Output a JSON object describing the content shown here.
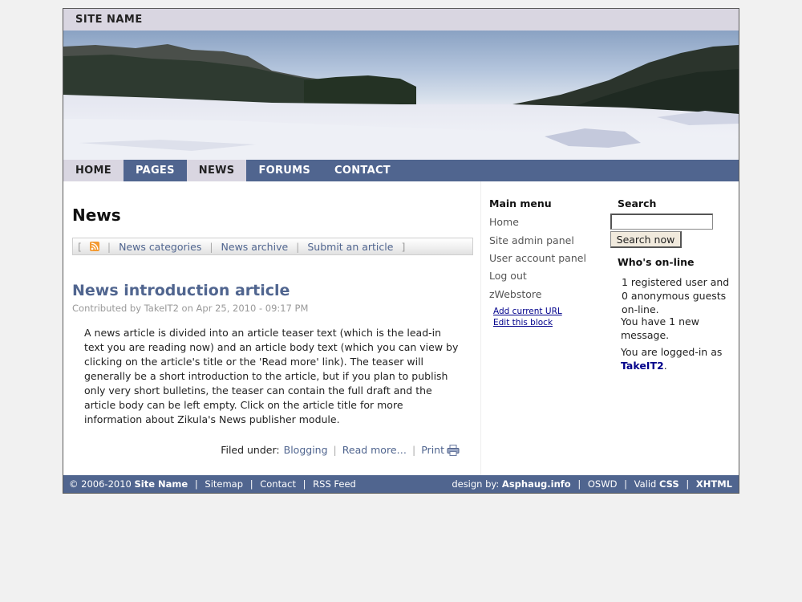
{
  "site": {
    "name": "SITE NAME"
  },
  "nav": {
    "items": [
      "HOME",
      "PAGES",
      "NEWS",
      "FORUMS",
      "CONTACT"
    ],
    "active": "NEWS"
  },
  "main": {
    "title": "News",
    "toolbar": {
      "open_bracket": "[",
      "close_bracket": "]",
      "separator": "|",
      "links": [
        "News categories",
        "News archive",
        "Submit an article"
      ]
    },
    "article": {
      "title": "News introduction article",
      "meta": "Contributed by TakeIT2 on Apr 25, 2010 - 09:17 PM",
      "body": "A news article is divided into an article teaser text (which is the lead-in text you are reading now) and an article body text (which you can view by clicking on the article's title or the 'Read more' link). The teaser will generally be a short introduction to the article, but if you plan to publish only very short bulletins, the teaser can contain the full draft and the article body can be left empty. Click on the article title for more information about Zikula's News publisher module.",
      "filed_under_label": "Filed under:",
      "category": "Blogging",
      "read_more": "Read more…",
      "print": "Print"
    }
  },
  "main_menu": {
    "title": "Main menu",
    "items": [
      "Home",
      "Site admin panel",
      "User account panel",
      "Log out",
      "zWebstore"
    ],
    "admin_links": [
      "Add current URL",
      "Edit this block"
    ]
  },
  "search": {
    "title": "Search",
    "query": "",
    "button": "Search now"
  },
  "whos_online": {
    "title": "Who's on-line",
    "summary": "1 registered user and 0 anonymous guests on-line.",
    "messages": "You have 1 new message.",
    "logged_in_prefix": "You are logged-in as",
    "username": "TakeIT2",
    "suffix": "."
  },
  "footer": {
    "copyright": "© 2006-2010",
    "site_name": "Site Name",
    "separator": "|",
    "links": [
      "Sitemap",
      "Contact",
      "RSS Feed"
    ],
    "design_label": "design by:",
    "designer": "Asphaug.info",
    "oswd": "OSWD",
    "valid_label": "Valid",
    "css": "CSS",
    "xhtml": "XHTML"
  },
  "colors": {
    "accent": "#50658f",
    "nav_active_bg": "#d9d6e1",
    "link_dark": "#00008b"
  }
}
